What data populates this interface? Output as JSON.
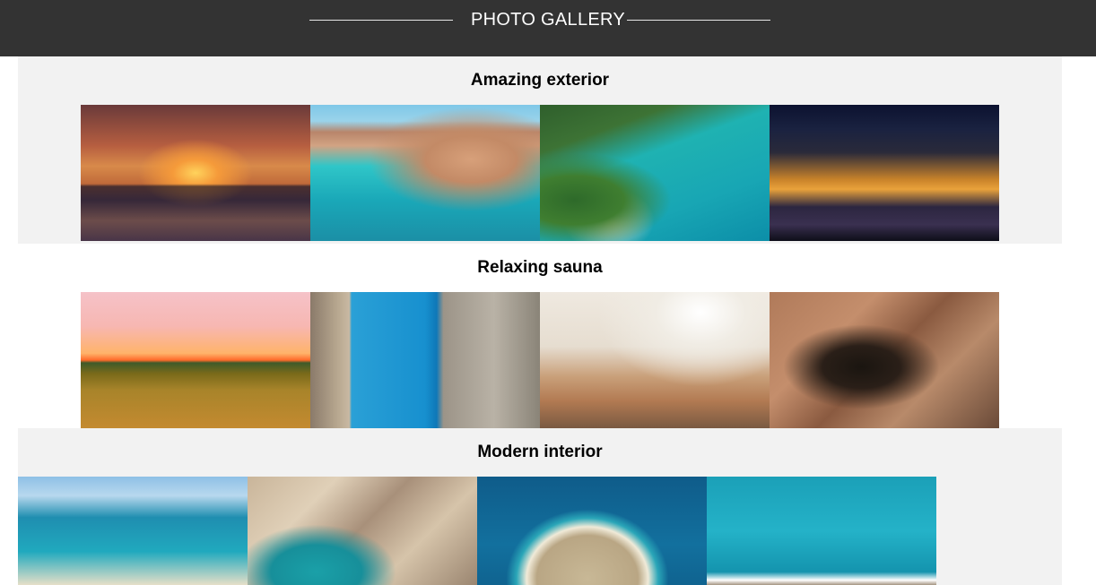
{
  "header": {
    "title": "PHOTO GALLERY"
  },
  "sections": [
    {
      "title": "Amazing exterior",
      "background": "#f2f2f2",
      "photos": [
        "sunset-beach-reflection",
        "old-town-coast",
        "aerial-bay-boats",
        "harbor-night-lights"
      ]
    },
    {
      "title": "Relaxing sauna",
      "background": "#ffffff",
      "photos": [
        "sunflower-field-sunset",
        "narrow-street-sea-view",
        "cathedral-towers",
        "sea-cave-cliff-climber"
      ]
    },
    {
      "title": "Modern interior",
      "background": "#f2f2f2",
      "photos": [
        "rocky-beach-cove",
        "aerial-rocks-lagoon",
        "aerial-island-stone-walls",
        "pool-ladder-sea"
      ]
    }
  ],
  "colors": {
    "header_bg": "#333333",
    "section_grey": "#f2f2f2",
    "header_text": "#ffffff"
  }
}
